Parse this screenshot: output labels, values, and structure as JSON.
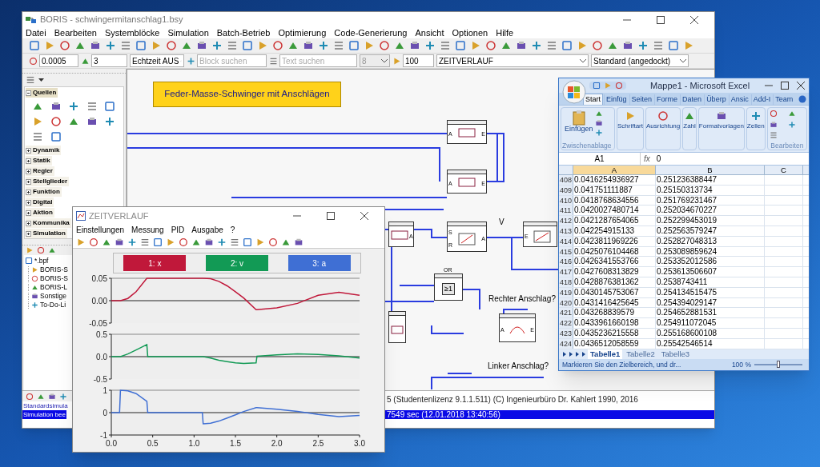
{
  "boris": {
    "title": "BORIS - schwingermitanschlag1.bsy",
    "menu": [
      "Datei",
      "Bearbeiten",
      "Systemblöcke",
      "Simulation",
      "Batch-Betrieb",
      "Optimierung",
      "Code-Generierung",
      "Ansicht",
      "Optionen",
      "Hilfe"
    ],
    "fields": [
      {
        "kind": "spin",
        "value": "0.0005",
        "disabled": false
      },
      {
        "kind": "spin",
        "value": "3",
        "disabled": false
      },
      {
        "kind": "select",
        "value": "Echtzeit AUS",
        "disabled": false
      },
      {
        "kind": "search",
        "placeholder": "Block suchen",
        "disabled": false
      },
      {
        "kind": "search",
        "placeholder": "Text suchen",
        "disabled": false
      },
      {
        "kind": "select",
        "value": "8",
        "disabled": true
      },
      {
        "kind": "spin",
        "value": "100",
        "disabled": false
      },
      {
        "kind": "select",
        "value": "ZEITVERLAUF",
        "disabled": false
      },
      {
        "kind": "select",
        "value": "Standard (angedockt)",
        "disabled": false
      }
    ],
    "palette": [
      {
        "label": "Quellen",
        "expanded": true
      },
      {
        "label": "Dynamik",
        "expanded": false
      },
      {
        "label": "Statik",
        "expanded": false
      },
      {
        "label": "Regler",
        "expanded": false
      },
      {
        "label": "Stellglieder",
        "expanded": false
      },
      {
        "label": "Funktion",
        "expanded": false
      },
      {
        "label": "Digital",
        "expanded": false
      },
      {
        "label": "Aktion",
        "expanded": false
      },
      {
        "label": "Kommunika",
        "expanded": false
      },
      {
        "label": "Simulation",
        "expanded": false
      }
    ],
    "tree": {
      "label": "*.bpf",
      "children": [
        {
          "label": "BORIS-S"
        },
        {
          "label": "BORIS-S"
        },
        {
          "label": "BORIS-L"
        },
        {
          "label": "Sonstige"
        },
        {
          "label": "To-Do-Li"
        }
      ]
    },
    "diagram": {
      "title": "Feder-Masse-Schwinger mit Anschlägen",
      "blocks": [
        {
          "kind": "plain",
          "inputs": [
            "A"
          ],
          "outputs": [
            "E"
          ]
        },
        {
          "kind": "plain",
          "inputs": [
            "A"
          ],
          "outputs": [
            "E"
          ]
        },
        {
          "kind": "plain",
          "outputs": [
            "A"
          ]
        },
        {
          "kind": "logic",
          "inputs": [
            "S",
            "R"
          ],
          "outputs": [
            "A"
          ]
        },
        {
          "kind": "ramp",
          "inputs": [
            "E"
          ]
        },
        {
          "kind": "or",
          "symbol": "≥1",
          "label": "OR"
        },
        {
          "kind": "curve",
          "inputs": [
            "A"
          ],
          "outputs": [
            "E"
          ]
        },
        {
          "kind": "stub"
        }
      ],
      "labels": [
        "V",
        "Rechter Anschlag?",
        "Linker Anschlag?"
      ]
    },
    "log": [
      {
        "left": "Standardsimula",
        "right": "5 (Studentenlizenz 9.1.1.511)  (C) Ingenieurbüro Dr. Kahlert 1990, 2016",
        "selected": false
      },
      {
        "left": "Simulation bee",
        "right": "7549 sec   (12.01.2018 13:40:56)",
        "selected": true
      }
    ]
  },
  "zeitverlauf": {
    "title": "ZEITVERLAUF",
    "menu": [
      "Einstellungen",
      "Messung",
      "PID",
      "Ausgabe",
      "?"
    ],
    "plots": [
      {
        "chart_data": {
          "type": "line",
          "x": [
            0,
            0.1,
            0.11,
            0.2,
            0.3,
            0.43,
            0.44,
            0.5,
            1.0,
            1.1,
            1.11,
            1.2,
            1.3,
            1.4,
            1.5,
            1.6,
            1.75,
            1.76,
            2.0,
            2.25,
            2.5,
            2.75,
            3.0
          ],
          "series": [
            {
              "name": "1: x",
              "color": "#c0183a",
              "values": [
                0,
                0,
                0,
                0.005,
                0.02,
                0.05,
                0.05,
                0.05,
                0.05,
                0.05,
                0.05,
                0.049,
                0.043,
                0.033,
                0.02,
                0.006,
                -0.02,
                -0.02,
                -0.016,
                -0.006,
                0.012,
                0.019,
                0.012
              ]
            }
          ],
          "xlim": [
            0,
            3
          ],
          "ylim": [
            -0.05,
            0.05
          ],
          "yticks": [
            {
              "value": 0.05,
              "label": "0.05"
            },
            {
              "value": 0,
              "label": "0.00"
            },
            {
              "value": -0.05,
              "label": "-0.05"
            }
          ]
        }
      },
      {
        "chart_data": {
          "type": "line",
          "x": [
            0,
            0.1,
            0.11,
            0.2,
            0.3,
            0.43,
            0.44,
            0.5,
            1.0,
            1.1,
            1.11,
            1.2,
            1.3,
            1.4,
            1.5,
            1.6,
            1.75,
            1.76,
            2.0,
            2.25,
            2.5,
            2.75,
            3.0
          ],
          "series": [
            {
              "name": "2: v",
              "color": "#129a55",
              "values": [
                0,
                0,
                0,
                0.06,
                0.15,
                0.27,
                0,
                0,
                0,
                0,
                0,
                -0.03,
                -0.08,
                -0.11,
                -0.14,
                -0.15,
                -0.14,
                0.01,
                0.04,
                0.06,
                0.05,
                0.02,
                -0.03
              ]
            }
          ],
          "xlim": [
            0,
            3
          ],
          "ylim": [
            -0.5,
            0.5
          ],
          "yticks": [
            {
              "value": 0.5,
              "label": "0.5"
            },
            {
              "value": 0,
              "label": "0.0"
            },
            {
              "value": -0.5,
              "label": "-0.5"
            }
          ]
        }
      },
      {
        "chart_data": {
          "type": "line",
          "x": [
            0,
            0.1,
            0.11,
            0.2,
            0.3,
            0.43,
            0.44,
            0.5,
            1.0,
            1.1,
            1.11,
            1.2,
            1.3,
            1.4,
            1.5,
            1.6,
            1.75,
            1.76,
            2.0,
            2.25,
            2.5,
            2.75,
            3.0
          ],
          "series": [
            {
              "name": "3: a",
              "color": "#3f6fd4",
              "values": [
                0,
                0,
                1,
                0.97,
                0.85,
                0.5,
                0,
                0,
                0,
                0,
                -0.5,
                -0.47,
                -0.38,
                -0.24,
                -0.1,
                0.05,
                0.22,
                0.22,
                0.15,
                0.05,
                -0.08,
                -0.18,
                -0.13
              ]
            }
          ],
          "xlim": [
            0,
            3
          ],
          "ylim": [
            -1,
            1
          ],
          "yticks": [
            {
              "value": 1,
              "label": "1"
            },
            {
              "value": 0,
              "label": "0"
            },
            {
              "value": -1,
              "label": "-1"
            }
          ],
          "xticks": [
            {
              "value": 0,
              "label": "0.0"
            },
            {
              "value": 0.5,
              "label": "0.5"
            },
            {
              "value": 1,
              "label": "1.0"
            },
            {
              "value": 1.5,
              "label": "1.5"
            },
            {
              "value": 2,
              "label": "2.0"
            },
            {
              "value": 2.5,
              "label": "2.5"
            },
            {
              "value": 3,
              "label": "3.0"
            }
          ]
        }
      }
    ]
  },
  "excel": {
    "title": "Mappe1 - Microsoft Excel",
    "tabs": [
      {
        "label": "Start",
        "selected": true
      },
      {
        "label": "Einfüg",
        "selected": false
      },
      {
        "label": "Seiten",
        "selected": false
      },
      {
        "label": "Forme",
        "selected": false
      },
      {
        "label": "Daten",
        "selected": false
      },
      {
        "label": "Überp",
        "selected": false
      },
      {
        "label": "Ansic",
        "selected": false
      },
      {
        "label": "Add-I",
        "selected": false
      },
      {
        "label": "Team",
        "selected": false
      }
    ],
    "paste": "Einfügen",
    "clipboard_group": "Zwischenablage",
    "groups": [
      "Schriftart",
      "Ausrichtung",
      "Zahl",
      "Formatvorlagen",
      "Zellen"
    ],
    "editing_group": "Bearbeiten",
    "name_box": "A1",
    "function_label": "fx",
    "formula": "0",
    "columns": [
      "A",
      "B",
      "C"
    ],
    "rows": [
      {
        "header": "408",
        "cells": [
          "0.0416254936927",
          "0.251236388447"
        ]
      },
      {
        "header": "409",
        "cells": [
          "0.041751111887",
          "0.25150313734"
        ]
      },
      {
        "header": "410",
        "cells": [
          "0.0418768634556",
          "0.251769231467"
        ]
      },
      {
        "header": "411",
        "cells": [
          "0.0420027480714",
          "0.252034670227"
        ]
      },
      {
        "header": "412",
        "cells": [
          "0.0421287654065",
          "0.252299453019"
        ]
      },
      {
        "header": "413",
        "cells": [
          "0.042254915133",
          "0.252563579247"
        ]
      },
      {
        "header": "414",
        "cells": [
          "0.0423811969226",
          "0.252827048313"
        ]
      },
      {
        "header": "415",
        "cells": [
          "0.0425076104468",
          "0.253089859624"
        ]
      },
      {
        "header": "416",
        "cells": [
          "0.0426341553766",
          "0.253352012586"
        ]
      },
      {
        "header": "417",
        "cells": [
          "0.0427608313829",
          "0.253613506607"
        ]
      },
      {
        "header": "418",
        "cells": [
          "0.0428876381362",
          "0.2538743411"
        ]
      },
      {
        "header": "419",
        "cells": [
          "0.0430145753067",
          "0.254134515475"
        ]
      },
      {
        "header": "420",
        "cells": [
          "0.0431416425645",
          "0.254394029147"
        ]
      },
      {
        "header": "421",
        "cells": [
          "0.043268839579",
          "0.254652881531"
        ]
      },
      {
        "header": "422",
        "cells": [
          "0.0433961660198",
          "0.254911072045"
        ]
      },
      {
        "header": "423",
        "cells": [
          "0.0435236215558",
          "0.255168600108"
        ]
      },
      {
        "header": "424",
        "cells": [
          "0.0436512058559",
          "0.25542546514"
        ]
      }
    ],
    "sheets": [
      {
        "label": "Tabelle1",
        "selected": true
      },
      {
        "label": "Tabelle2",
        "selected": false
      },
      {
        "label": "Tabelle3",
        "selected": false
      }
    ],
    "status": "Markieren Sie den Zielbereich, und dr...",
    "zoom": "100 %",
    "zoom_slider": {
      "level": 0.5
    }
  }
}
